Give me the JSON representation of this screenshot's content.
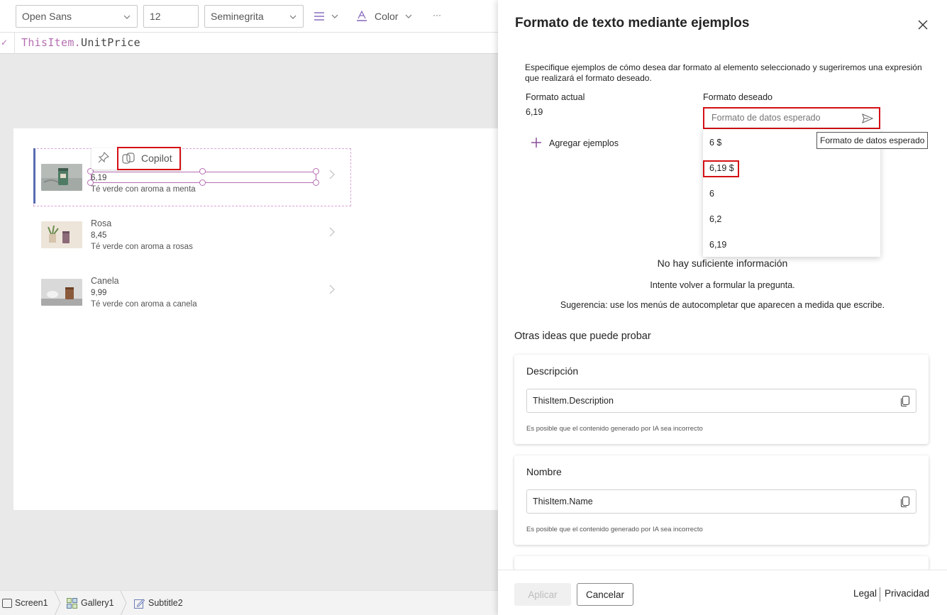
{
  "toolbar": {
    "font": "Open Sans",
    "size": "12",
    "weight": "Seminegrita",
    "color_label": "Color",
    "more": "···"
  },
  "formula": {
    "object": "ThisItem.",
    "property": "UnitPrice"
  },
  "copilot_label": "Copilot",
  "gallery": [
    {
      "title": "",
      "price": "6,19",
      "subtitle": "Té verde con aroma a menta"
    },
    {
      "title": "Rosa",
      "price": "8,45",
      "subtitle": "Té verde con aroma a rosas"
    },
    {
      "title": "Canela",
      "price": "9,99",
      "subtitle": "Té verde con aroma a canela"
    }
  ],
  "breadcrumbs": [
    "Screen1",
    "Gallery1",
    "Subtitle2"
  ],
  "panel": {
    "title": "Formato de texto mediante ejemplos",
    "description": "Especifique ejemplos de cómo desea dar formato al elemento seleccionado y sugeriremos una expresión que realizará el formato deseado.",
    "current_label": "Formato actual",
    "current_value": "6,19",
    "desired_label": "Formato deseado",
    "desired_placeholder": "Formato de datos esperado",
    "tooltip": "Formato de datos esperado",
    "add_examples": "Agregar ejemplos",
    "suggestions": [
      "6 $",
      "6,19 $",
      "6",
      "6,2",
      "6,19"
    ],
    "no_info": "No hay suficiente información",
    "retry": "Intente volver a formular la pregunta.",
    "tip": "Sugerencia: use los menús de autocompletar que aparecen a medida que escribe.",
    "other_ideas": "Otras ideas que puede probar",
    "ideas": [
      {
        "title": "Descripción",
        "expression": "ThisItem.Description",
        "disclaimer": "Es posible que el contenido generado por IA sea incorrecto"
      },
      {
        "title": "Nombre",
        "expression": "ThisItem.Name",
        "disclaimer": "Es posible que el contenido generado por IA sea incorrecto"
      }
    ],
    "apply": "Aplicar",
    "cancel": "Cancelar",
    "legal": "Legal",
    "privacy": "Privacidad"
  },
  "colors": {
    "highlight": "#d40f14",
    "formula_keyword": "#b56eb2",
    "selection": "#b56eb2",
    "accent_bar": "#5a6bb3"
  }
}
